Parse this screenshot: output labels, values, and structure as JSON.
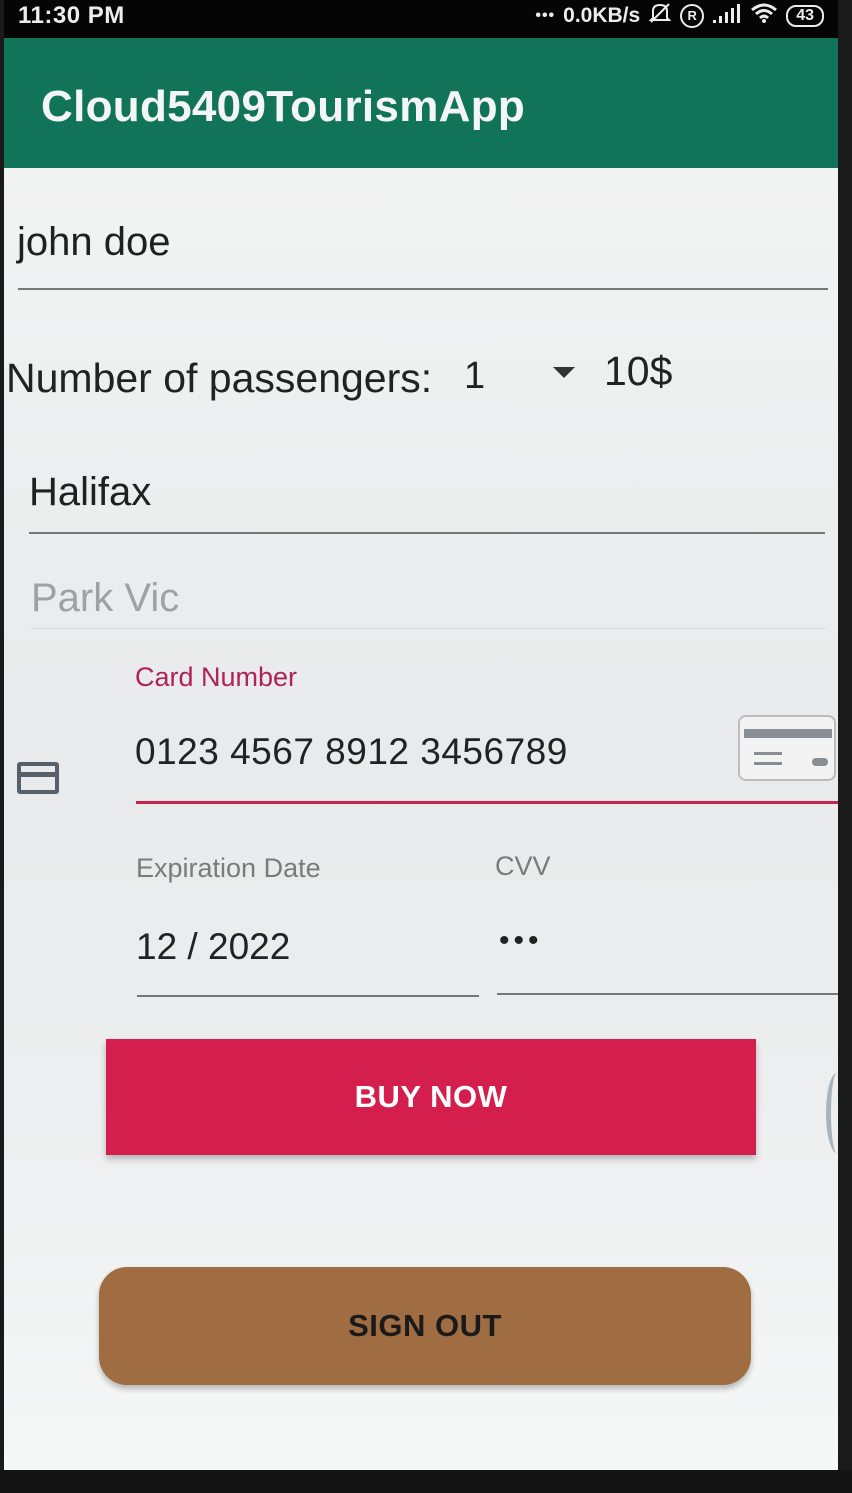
{
  "status_bar": {
    "time": "11:30 PM",
    "dots": "•••",
    "network_speed": "0.0KB/s",
    "r_badge": "R",
    "battery": "43",
    "icons": [
      "mute-icon",
      "roaming-icon",
      "signal-icon",
      "wifi-icon",
      "battery-icon"
    ]
  },
  "app_bar": {
    "title": "Cloud5409TourismApp",
    "color": "#117458"
  },
  "form": {
    "name_value": "john doe",
    "passengers_label": "Number of passengers:",
    "passengers_value": "1",
    "price": "10$",
    "city_value": "Halifax",
    "hotel_value": "Park Vic",
    "card_number_label": "Card Number",
    "card_number_value": "0123 4567 8912 3456789",
    "expiration_label": "Expiration Date",
    "expiration_value": "12 / 2022",
    "cvv_label": "CVV",
    "cvv_value": "•••"
  },
  "buttons": {
    "buy_label": "BUY NOW",
    "buy_color": "#d41f4e",
    "signout_label": "SIGN OUT",
    "signout_color": "#a06d42"
  }
}
